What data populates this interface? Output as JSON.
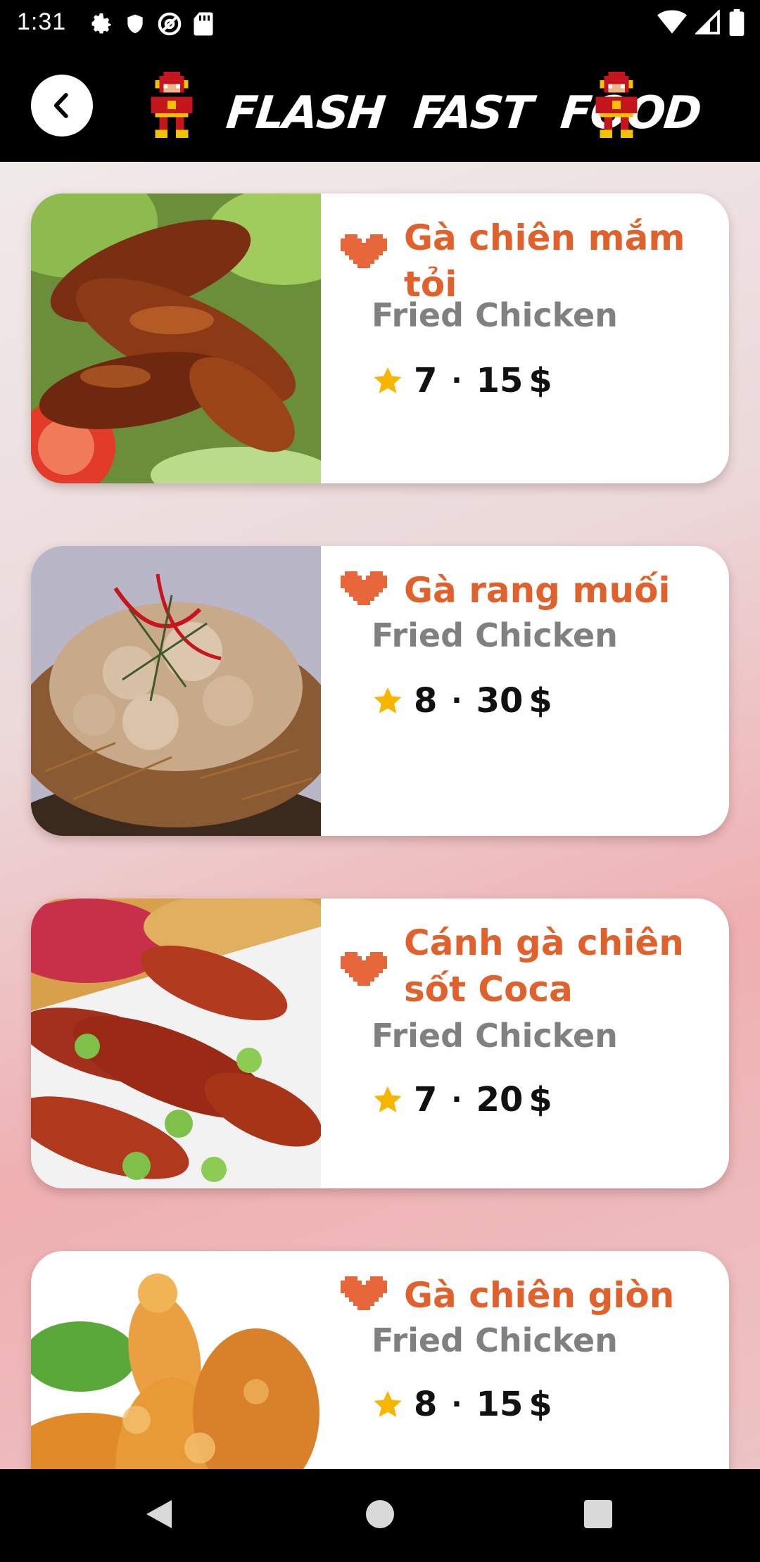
{
  "status_bar": {
    "time": "1:31",
    "left_icons": [
      "settings-icon",
      "shield-icon",
      "at-sign-icon",
      "sd-card-icon"
    ],
    "right_icons": [
      "wifi-icon",
      "signal-icon",
      "battery-icon"
    ]
  },
  "app_bar": {
    "title": "FLASH FAST FOOD",
    "back_icon": "chevron-left-icon"
  },
  "colors": {
    "accent": "#e0612b",
    "subtitle": "#808080",
    "star": "#f7b500"
  },
  "items": [
    {
      "title": "Gà chiên mắm tỏi",
      "category": "Fried Chicken",
      "rating": "7",
      "price": "15",
      "currency": "$"
    },
    {
      "title": "Gà rang muối",
      "category": "Fried Chicken",
      "rating": "8",
      "price": "30",
      "currency": "$"
    },
    {
      "title": "Cánh gà chiên sốt Coca",
      "category": "Fried Chicken",
      "rating": "7",
      "price": "20",
      "currency": "$"
    },
    {
      "title": "Gà chiên giòn",
      "category": "Fried Chicken",
      "rating": "8",
      "price": "15",
      "currency": "$"
    }
  ],
  "separator": "·",
  "nav_bar": {
    "buttons": [
      "back-triangle-icon",
      "home-circle-icon",
      "recents-square-icon"
    ]
  }
}
